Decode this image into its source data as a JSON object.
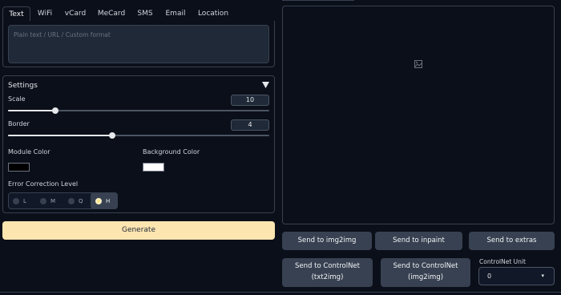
{
  "tabs": [
    "Text",
    "WiFi",
    "vCard",
    "MeCard",
    "SMS",
    "Email",
    "Location"
  ],
  "text_input": {
    "placeholder": "Plain text / URL / Custom format",
    "value": ""
  },
  "settings": {
    "title": "Settings",
    "scale": {
      "label": "Scale",
      "value": "10",
      "fraction": 0.18
    },
    "border": {
      "label": "Border",
      "value": "4",
      "fraction": 0.4
    },
    "module_color": {
      "label": "Module Color",
      "color": "#000000"
    },
    "background_color": {
      "label": "Background Color",
      "color": "#ffffff"
    },
    "error_correction": {
      "label": "Error Correction Level",
      "options": [
        "L",
        "M",
        "Q",
        "H"
      ],
      "selected": "H"
    }
  },
  "generate_label": "Generate",
  "actions": {
    "send_img2img": "Send to img2img",
    "send_inpaint": "Send to inpaint",
    "send_extras": "Send to extras",
    "send_controlnet_txt2img_l1": "Send to ControlNet",
    "send_controlnet_txt2img_l2": "(txt2img)",
    "send_controlnet_img2img_l1": "Send to ControlNet",
    "send_controlnet_img2img_l2": "(img2img)"
  },
  "controlnet_unit": {
    "label": "ControlNet Unit",
    "value": "0"
  },
  "colors": {
    "accent": "#fde5b0",
    "background": "#0b0f19",
    "button": "#374151"
  }
}
